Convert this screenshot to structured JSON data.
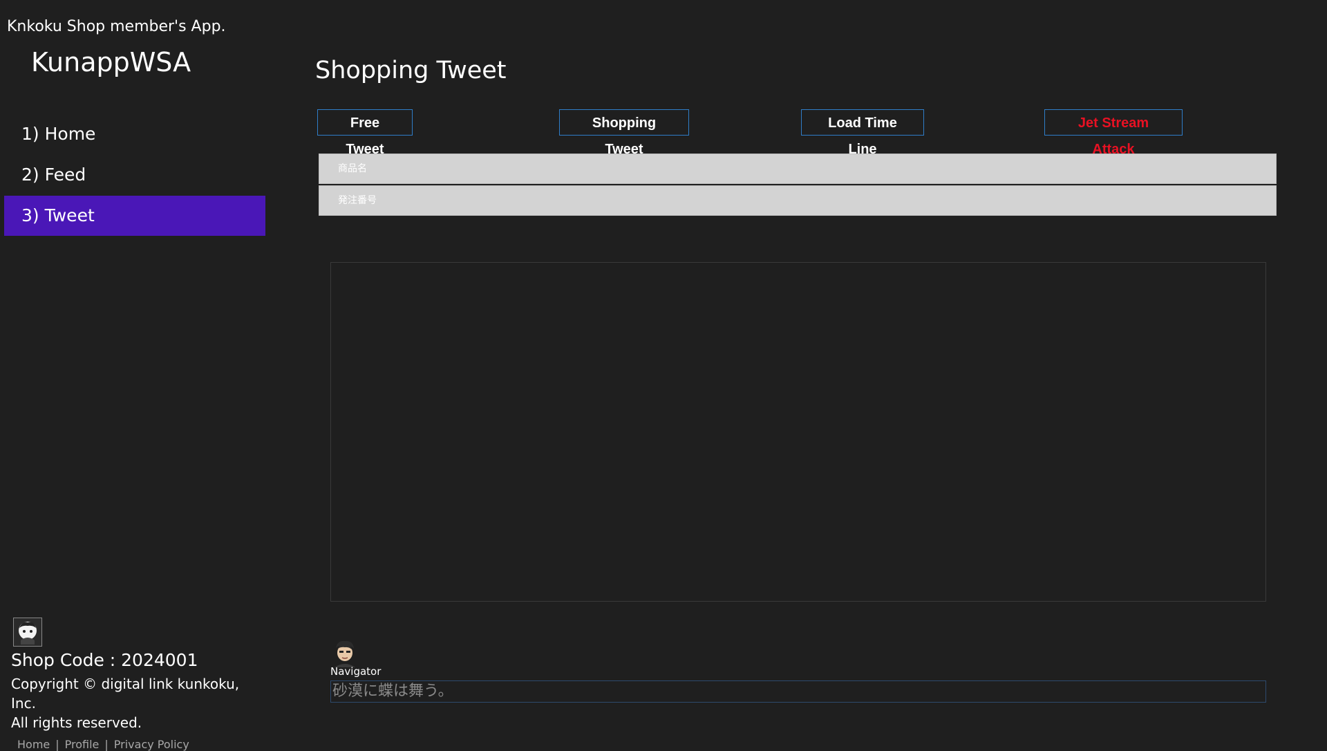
{
  "app": {
    "caption": "Knkoku Shop member's App.",
    "title": "KunappWSA"
  },
  "nav": {
    "items": [
      {
        "label": "1) Home"
      },
      {
        "label": "2) Feed"
      },
      {
        "label": "3) Tweet",
        "active": true
      }
    ],
    "active_color": "#4a17b7"
  },
  "footer": {
    "avatar_icon": "character-avatar-icon",
    "shop_code": "Shop Code : 2024001",
    "copyright_line1": "Copyright © digital link kunkoku, Inc.",
    "copyright_line2": "All rights reserved.",
    "links": [
      "Home",
      "Profile",
      "Privacy Policy"
    ]
  },
  "main": {
    "page_title": "Shopping Tweet",
    "buttons": {
      "free_tweet": "Free Tweet",
      "shopping_tweet": "Shopping Tweet",
      "load_time_line": "Load Time Line",
      "jet_stream_attack": "Jet Stream Attack"
    },
    "accent_color": "#2f7ec9",
    "danger_color": "#e81123",
    "inputs": {
      "product_name_placeholder": "商品名",
      "order_number_placeholder": "発注番号"
    },
    "navigator": {
      "avatar_icon": "navigator-avatar-icon",
      "label": "Navigator",
      "message": "砂漠に蝶は舞う。"
    }
  }
}
